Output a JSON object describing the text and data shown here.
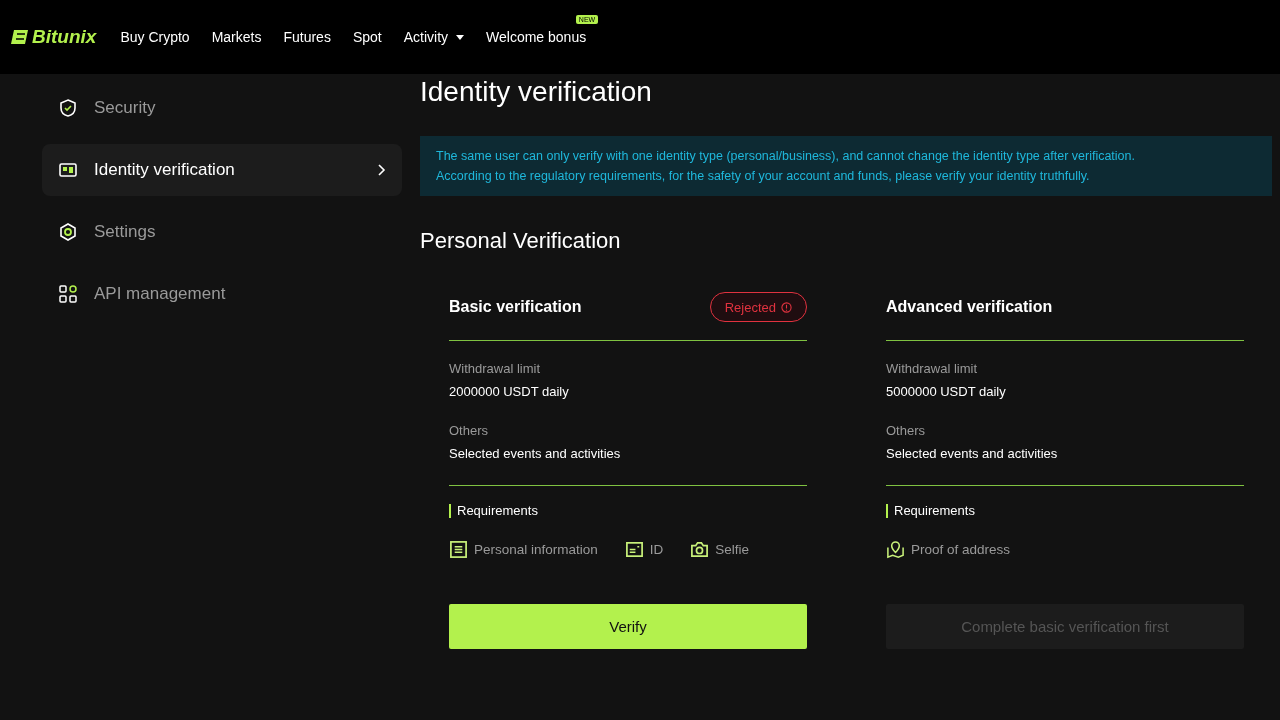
{
  "header": {
    "logo": "Bitunix",
    "nav": [
      {
        "label": "Buy Crypto",
        "kind": "link"
      },
      {
        "label": "Markets",
        "kind": "link"
      },
      {
        "label": "Futures",
        "kind": "link"
      },
      {
        "label": "Spot",
        "kind": "link"
      },
      {
        "label": "Activity",
        "kind": "dropdown"
      },
      {
        "label": "Welcome bonus",
        "kind": "link",
        "badge": "NEW"
      }
    ]
  },
  "sidebar": {
    "items": [
      {
        "label": "Security",
        "kind": "shield",
        "selected": false
      },
      {
        "label": "Identity verification",
        "kind": "idcard",
        "selected": true
      },
      {
        "label": "Settings",
        "kind": "hexagon",
        "selected": false
      },
      {
        "label": "API management",
        "kind": "grid",
        "selected": false
      }
    ]
  },
  "page": {
    "title": "Identity verification",
    "notice": [
      "The same user can only verify with one identity type (personal/business), and cannot change the identity type after verification.",
      "According to the regulatory requirements, for the safety of your account and funds, please verify your identity truthfully."
    ],
    "section_title": "Personal Verification",
    "cards": [
      {
        "title": "Basic verification",
        "status": "Rejected",
        "limit_label": "Withdrawal limit",
        "limit_value": "2000000 USDT daily",
        "others_label": "Others",
        "others_value": "Selected events and activities",
        "requirements_label": "Requirements",
        "requirements": [
          {
            "label": "Personal information",
            "kind": "list"
          },
          {
            "label": "ID",
            "kind": "id"
          },
          {
            "label": "Selfie",
            "kind": "camera"
          }
        ],
        "button": {
          "label": "Verify",
          "disabled": false
        }
      },
      {
        "title": "Advanced verification",
        "limit_label": "Withdrawal limit",
        "limit_value": "5000000 USDT daily",
        "others_label": "Others",
        "others_value": "Selected events and activities",
        "requirements_label": "Requirements",
        "requirements": [
          {
            "label": "Proof of address",
            "kind": "map"
          }
        ],
        "button": {
          "label": "Complete basic verification first",
          "disabled": true
        }
      }
    ]
  }
}
